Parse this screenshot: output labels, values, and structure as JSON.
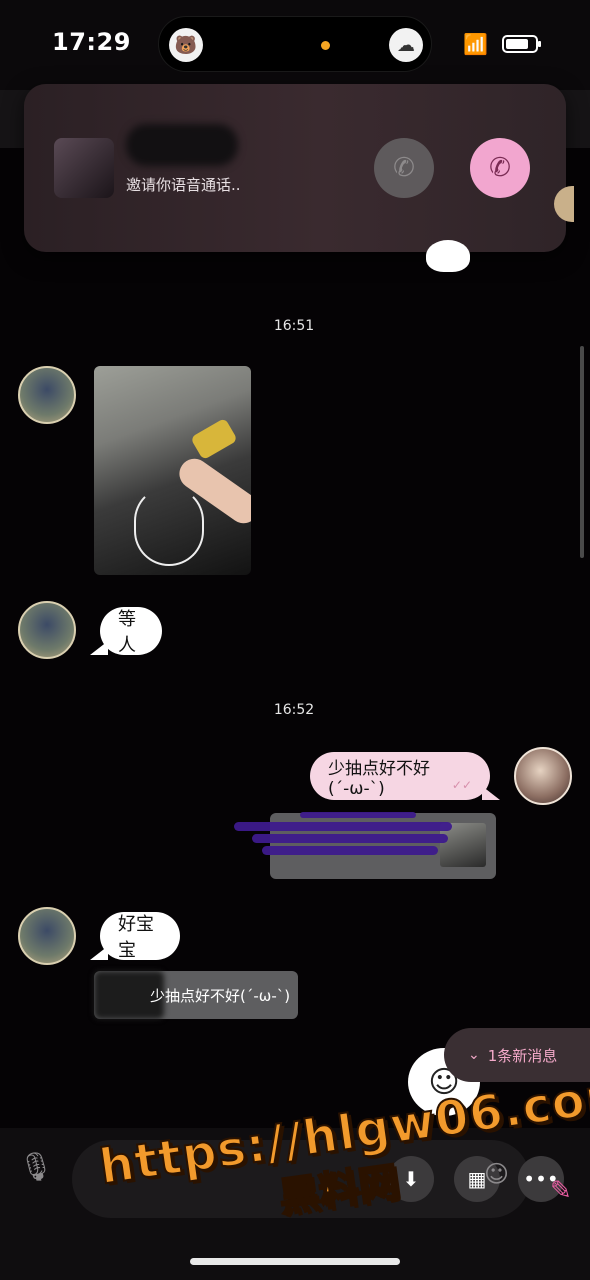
{
  "status_bar": {
    "time": "17:29"
  },
  "call_banner": {
    "caller_text": "邀请你语音通话.."
  },
  "messages": {
    "ts1": "16:51",
    "msg_wait": "等人",
    "ts2": "16:52",
    "my_msg": "少抽点好不好(´-ω-`)",
    "reply_text": "好宝宝",
    "quoted": "少抽点好不好(´-ω-`)"
  },
  "new_messages": {
    "label": "1条新消息"
  },
  "watermark": {
    "url": "https://hlgw06.com",
    "name": "黑料网"
  },
  "colors": {
    "accent_pink": "#f2a6cf",
    "watermark_orange": "#f29a2c"
  }
}
